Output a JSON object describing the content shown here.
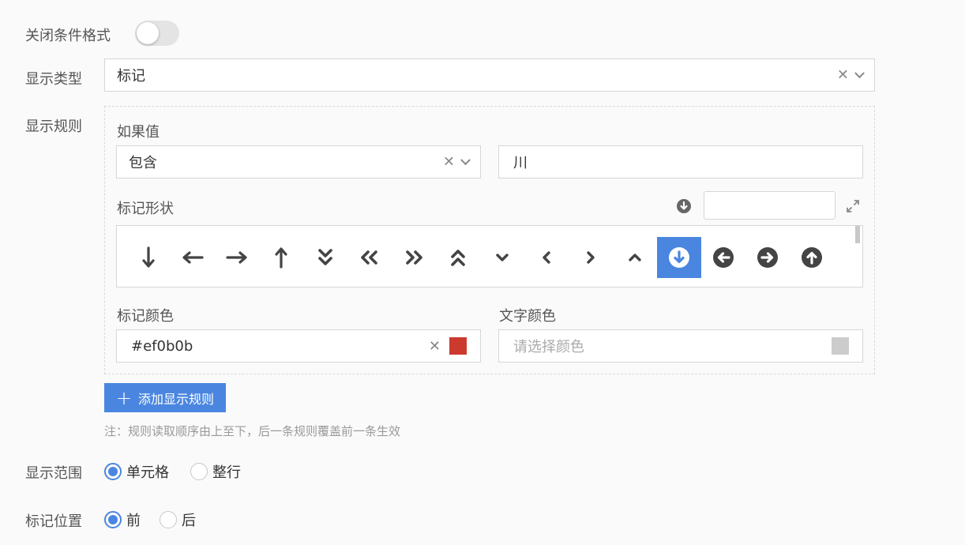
{
  "toggle": {
    "label": "关闭条件格式",
    "on": false
  },
  "display_type": {
    "label": "显示类型",
    "value": "标记"
  },
  "display_rules": {
    "label": "显示规则",
    "if_value_label": "如果值",
    "condition": "包含",
    "condition_value": "川",
    "shape_label": "标记形状",
    "shape_search_value": "",
    "shapes": [
      "arrow-down-icon",
      "arrow-left-icon",
      "arrow-right-icon",
      "arrow-up-icon",
      "double-chevron-down-icon",
      "double-chevron-left-icon",
      "double-chevron-right-icon",
      "double-chevron-up-icon",
      "chevron-down-icon",
      "chevron-left-icon",
      "chevron-right-icon",
      "chevron-up-icon",
      "circle-arrow-down-icon",
      "circle-arrow-left-icon",
      "circle-arrow-right-icon",
      "circle-arrow-up-icon"
    ],
    "selected_shape": "circle-arrow-down-icon",
    "mark_color_label": "标记颜色",
    "mark_color_value": "#ef0b0b",
    "mark_color_swatch": "#cc3a2e",
    "text_color_label": "文字颜色",
    "text_color_placeholder": "请选择颜色",
    "text_color_swatch": "#cccccc"
  },
  "add_rule_button": "添加显示规则",
  "note": "注：规则读取顺序由上至下，后一条规则覆盖前一条生效",
  "display_range": {
    "label": "显示范围",
    "options": [
      "单元格",
      "整行"
    ],
    "selected": "单元格"
  },
  "mark_position": {
    "label": "标记位置",
    "options": [
      "前",
      "后"
    ],
    "selected": "前"
  },
  "colors": {
    "accent": "#4a86e0",
    "icon_dark": "#444444"
  }
}
